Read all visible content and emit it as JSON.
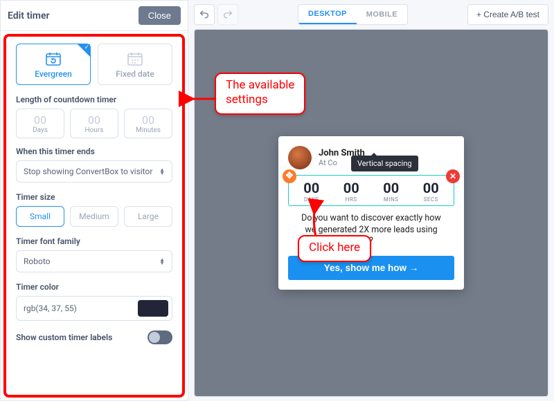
{
  "sidebar": {
    "title": "Edit timer",
    "close": "Close",
    "type_options": [
      {
        "label": "Evergreen",
        "selected": true
      },
      {
        "label": "Fixed date",
        "selected": false
      }
    ],
    "length_label": "Length of countdown timer",
    "units": [
      {
        "value": "00",
        "label": "Days"
      },
      {
        "value": "00",
        "label": "Hours"
      },
      {
        "value": "00",
        "label": "Minutes"
      }
    ],
    "end_label": "When this timer ends",
    "end_action": "Stop showing ConvertBox to visitor",
    "size_label": "Timer size",
    "sizes": [
      {
        "label": "Small",
        "active": true
      },
      {
        "label": "Medium",
        "active": false
      },
      {
        "label": "Large",
        "active": false
      }
    ],
    "font_label": "Timer font family",
    "font_value": "Roboto",
    "color_label": "Timer color",
    "color_value": "rgb(34, 37, 55)",
    "custom_labels_toggle": "Show custom timer labels"
  },
  "toolbar": {
    "desktop": "DESKTOP",
    "mobile": "MOBILE",
    "ab_test": "+ Create A/B test"
  },
  "widget": {
    "name": "John Smith",
    "role": "At Co",
    "tooltip": "Vertical spacing",
    "timer": [
      {
        "num": "00",
        "unit": "DAYS"
      },
      {
        "num": "00",
        "unit": "HRS"
      },
      {
        "num": "00",
        "unit": "MINS"
      },
      {
        "num": "00",
        "unit": "SECS"
      }
    ],
    "body_l1": "Do you want to discover exactly how",
    "body_l2": "we generated 2X more leads using",
    "body_l3": "?",
    "cta": "Yes, show me how →"
  },
  "annotations": {
    "settings": "The available\nsettings",
    "click": "Click here"
  }
}
